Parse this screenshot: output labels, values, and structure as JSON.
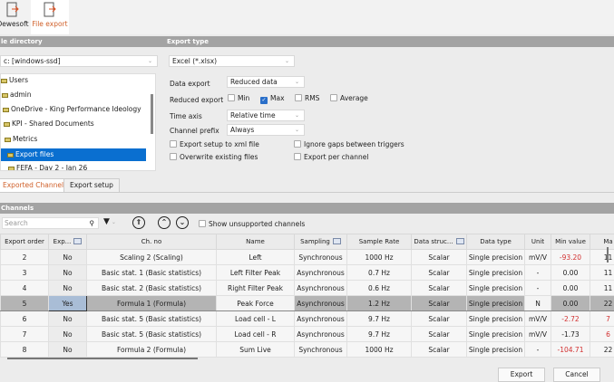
{
  "toolbar": {
    "dewesoft": "Dewesoft",
    "file_export": "File export"
  },
  "file_directory": {
    "title": "le directory",
    "drive": "c: [windows-ssd]",
    "tree": [
      "Users",
      "admin",
      "OneDrive - King Performance Ideology",
      "KPI - Shared Documents",
      "Metrics",
      "Export files",
      "FEFA - Day 2 - Jan 26"
    ],
    "selected": "Export files"
  },
  "export_type": {
    "title": "Export type",
    "format": "Excel (*.xlsx)",
    "data_export_label": "Data export",
    "data_export": "Reduced data",
    "reduced_export_label": "Reduced export",
    "min": "Min",
    "max": "Max",
    "rms": "RMS",
    "average": "Average",
    "time_axis_label": "Time axis",
    "time_axis": "Relative time",
    "channel_prefix_label": "Channel prefix",
    "channel_prefix": "Always",
    "xml": "Export setup to xml file",
    "overwrite": "Overwrite existing files",
    "ignore_gaps": "Ignore gaps between triggers",
    "per_channel": "Export per channel"
  },
  "tabs": [
    "Exported Channels",
    "Export setup"
  ],
  "channels": {
    "title": "Channels",
    "search_placeholder": "Search",
    "show_unsupported": "Show unsupported channels",
    "columns": [
      "Export order",
      "Exp...",
      "Ch. no",
      "Name",
      "Sampling",
      "Sample Rate",
      "Data struc...",
      "Data type",
      "Unit",
      "Min value",
      "Ma"
    ],
    "rows": [
      [
        "2",
        "No",
        "Scaling 2 (Scaling)",
        "Left",
        "Synchronous",
        "1000 Hz",
        "Scalar",
        "Single precision",
        "mV/V",
        "-93.20",
        "11"
      ],
      [
        "3",
        "No",
        "Basic stat. 1 (Basic statistics)",
        "Left Filter Peak",
        "Asynchronous",
        "0.7 Hz",
        "Scalar",
        "Single precision",
        "-",
        "0.00",
        "11"
      ],
      [
        "4",
        "No",
        "Basic stat. 2 (Basic statistics)",
        "Right Filter Peak",
        "Asynchronous",
        "0.6 Hz",
        "Scalar",
        "Single precision",
        "-",
        "0.00",
        "11"
      ],
      [
        "5",
        "Yes",
        "Formula 1 (Formula)",
        "Peak Force",
        "Asynchronous",
        "1.2 Hz",
        "Scalar",
        "Single precision",
        "N",
        "0.00",
        "22"
      ],
      [
        "6",
        "No",
        "Basic stat. 5 (Basic statistics)",
        "Load cell - L",
        "Asynchronous",
        "9.7 Hz",
        "Scalar",
        "Single precision",
        "mV/V",
        "-2.72",
        "7"
      ],
      [
        "7",
        "No",
        "Basic stat. 5 (Basic statistics)",
        "Load cell - R",
        "Asynchronous",
        "9.7 Hz",
        "Scalar",
        "Single precision",
        "mV/V",
        "-1.73",
        "6"
      ],
      [
        "8",
        "No",
        "Formula 2 (Formula)",
        "Sum Live",
        "Synchronous",
        "1000 Hz",
        "Scalar",
        "Single precision",
        "-",
        "-104.71",
        "22"
      ]
    ]
  },
  "buttons": {
    "export": "Export",
    "cancel": "Cancel"
  }
}
